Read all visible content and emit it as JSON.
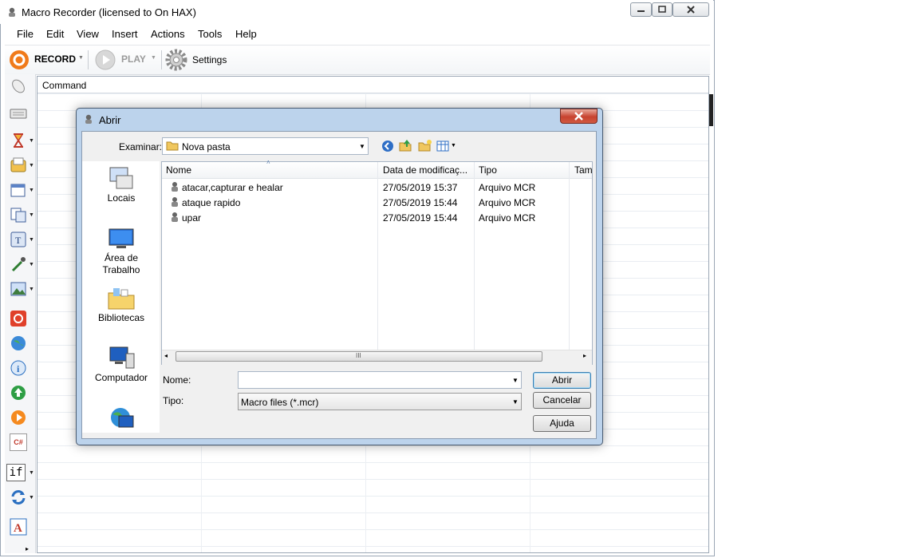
{
  "window": {
    "title": "Macro Recorder (licensed to On HAX)"
  },
  "menu": [
    "File",
    "Edit",
    "View",
    "Insert",
    "Actions",
    "Tools",
    "Help"
  ],
  "toolbar": {
    "record_label": "RECORD",
    "play_label": "PLAY",
    "settings_label": "Settings"
  },
  "grid": {
    "column_header": "Command"
  },
  "left_toolbar": {
    "icons": [
      "mouse-icon",
      "keyboard-icon",
      "hourglass-icon",
      "clipboard-icon",
      "window-icon",
      "copy-icon",
      "text-icon",
      "pipette-icon",
      "image-icon",
      "stop-icon",
      "web-icon",
      "info-icon",
      "upload-icon",
      "play-circle-icon",
      "csharp-icon",
      "if-icon",
      "loop-icon",
      "font-icon"
    ],
    "csharp_label": "C#",
    "if_label": "if"
  },
  "dialog": {
    "title": "Abrir",
    "look_in_label": "Examinar:",
    "look_in_value": "Nova pasta",
    "places": [
      "Locais",
      "Área de\nTrabalho",
      "Bibliotecas",
      "Computador"
    ],
    "columns": [
      "Nome",
      "Data de modificaç...",
      "Tipo",
      "Tam"
    ],
    "files": [
      {
        "name": "atacar,capturar e healar",
        "date": "27/05/2019 15:37",
        "type": "Arquivo MCR"
      },
      {
        "name": "ataque rapido",
        "date": "27/05/2019 15:44",
        "type": "Arquivo MCR"
      },
      {
        "name": "upar",
        "date": "27/05/2019 15:44",
        "type": "Arquivo MCR"
      }
    ],
    "scroll_grip": "III",
    "name_label": "Nome:",
    "name_value": "",
    "type_label": "Tipo:",
    "type_value": "Macro files (*.mcr)",
    "open_button": "Abrir",
    "cancel_button": "Cancelar",
    "help_button": "Ajuda"
  },
  "colors": {
    "record": "#f07a1a",
    "dialog_frame": "#bcd3ec",
    "close_red": "#c7432f",
    "accent_blue": "#3c7fb1"
  }
}
